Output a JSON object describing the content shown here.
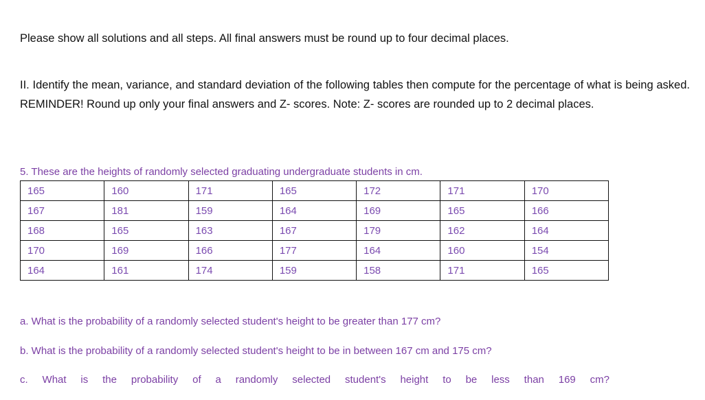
{
  "document": {
    "intro_paragraph": "Please show all solutions and all steps. All final answers must be round up to four decimal places.",
    "instruction_paragraph": "II. Identify the mean, variance, and standard deviation of the following tables then compute for the percentage of what is being asked. REMINDER! Round up only your final answers and Z- scores. Note: Z- scores are rounded up to 2 decimal places.",
    "question_number_prompt": "5. These are the heights of randomly selected graduating undergraduate students in cm.",
    "table": {
      "rows": [
        [
          "165",
          "160",
          "171",
          "165",
          "172",
          "171",
          "170"
        ],
        [
          "167",
          "181",
          "159",
          "164",
          "169",
          "165",
          "166"
        ],
        [
          "168",
          "165",
          "163",
          "167",
          "179",
          "162",
          "164"
        ],
        [
          "170",
          "169",
          "166",
          "177",
          "164",
          "160",
          "154"
        ],
        [
          "164",
          "161",
          "174",
          "159",
          "158",
          "171",
          "165"
        ]
      ]
    },
    "sub_questions": [
      "a. What is the probability of a randomly selected student's height to be greater than 177 cm?",
      "b. What is the probability of a randomly selected student's height to be in between 167 cm and 175 cm?",
      "c. What is the probability of a randomly selected student's height to be less than 169 cm?"
    ],
    "colors": {
      "body_text": "#111111",
      "accent_purple": "#7B3FA4",
      "table_value_purple": "#7B4BB0",
      "table_border": "#111111",
      "background": "#ffffff"
    }
  }
}
